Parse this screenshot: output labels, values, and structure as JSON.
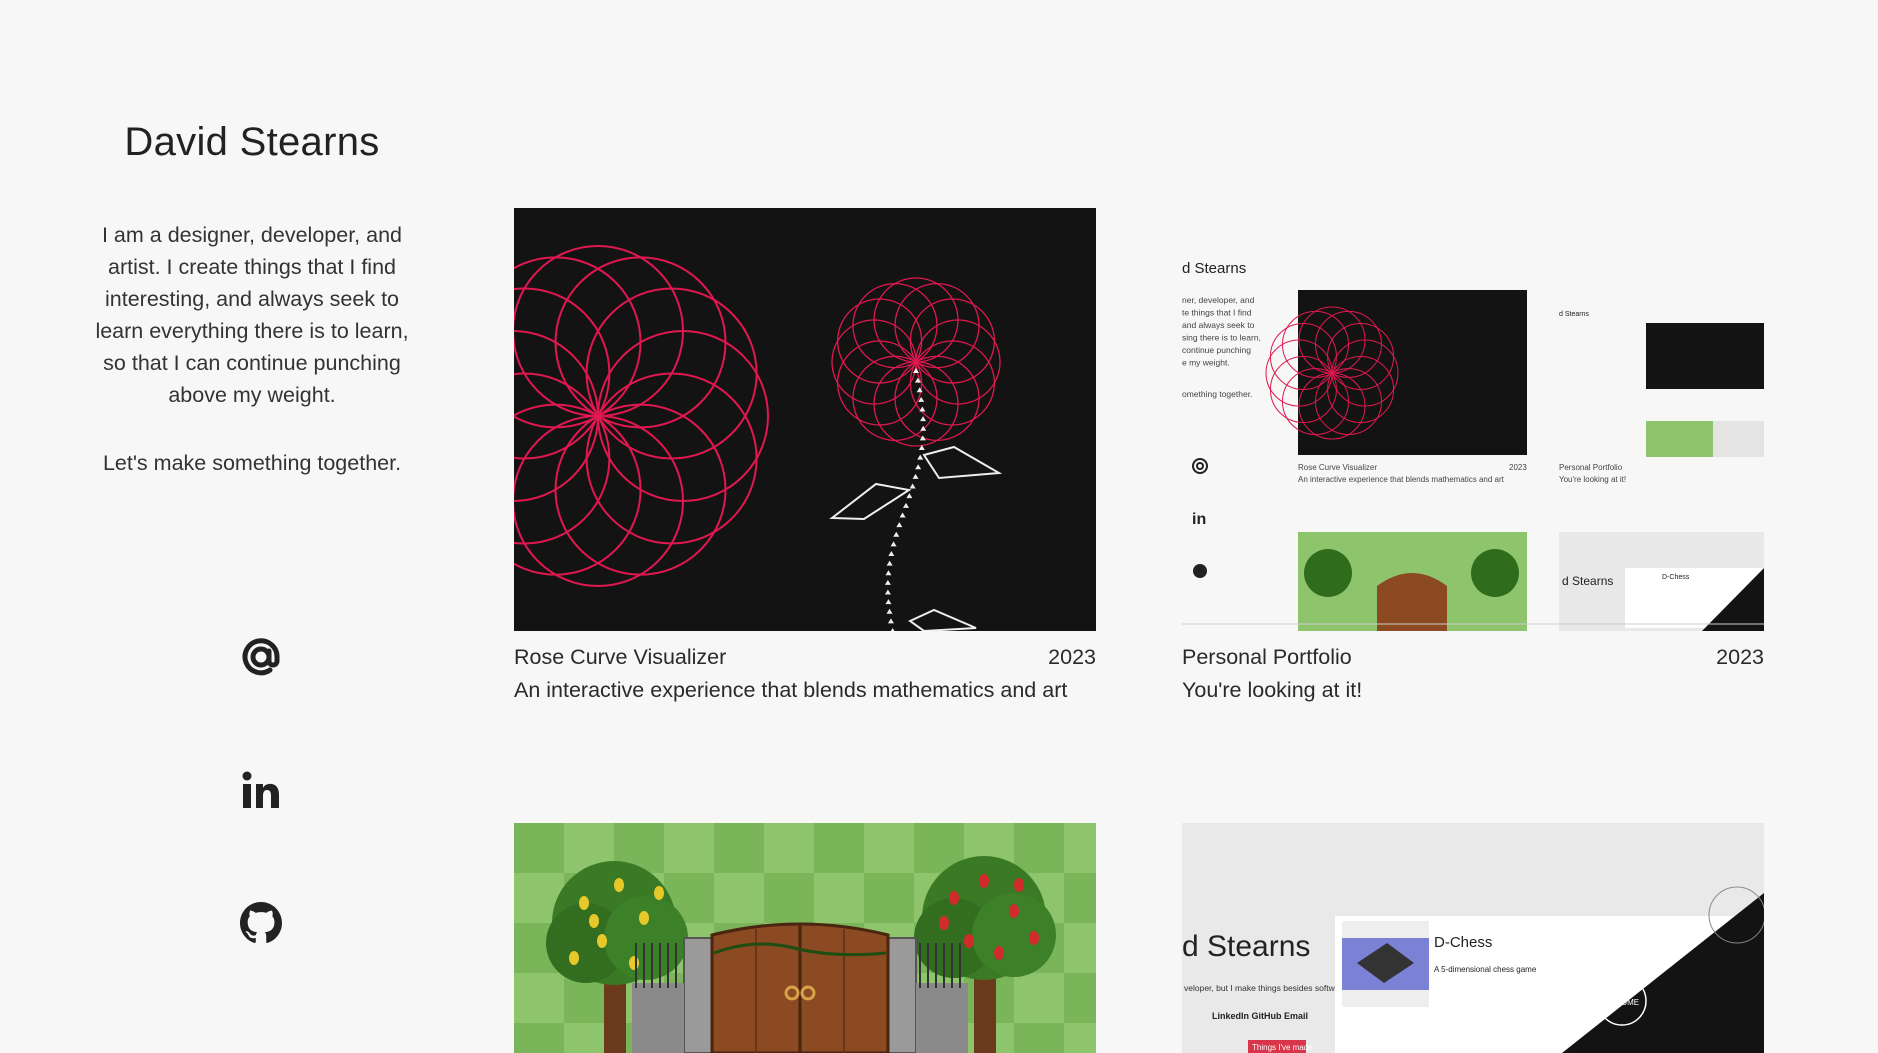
{
  "profile": {
    "name": "David Stearns",
    "bio": "I am a designer, developer, and artist. I create things that I find interesting, and always seek to learn everything there is to learn, so that I can continue punching above my weight.",
    "cta": "Let's make something together."
  },
  "social": [
    {
      "icon": "at-icon",
      "label": "Email"
    },
    {
      "icon": "linkedin-icon",
      "label": "LinkedIn"
    },
    {
      "icon": "github-icon",
      "label": "GitHub"
    }
  ],
  "projects": [
    {
      "title": "Rose Curve Visualizer",
      "year": "2023",
      "description": "An interactive experience that blends mathematics and art"
    },
    {
      "title": "Personal Portfolio",
      "year": "2023",
      "description": "You're looking at it!"
    },
    {
      "title": "",
      "year": "",
      "description": ""
    },
    {
      "title": "",
      "year": "",
      "description": ""
    }
  ],
  "preview": {
    "name_fragment": "d Stearns",
    "bio_fragment": [
      "ner, developer, and",
      "te things that I find",
      "and always seek to",
      "sing there is to learn,",
      "continue punching",
      "e my weight."
    ],
    "cta_fragment": "omething together.",
    "card1_title": "Rose Curve Visualizer",
    "card1_year": "2023",
    "card1_desc": "An interactive experience that blends mathematics and art",
    "card2_title": "Personal Portfolio",
    "card2_desc": "You're looking at it!",
    "small_name": "d Stearns",
    "dchess_title": "D-Chess",
    "dchess_desc": "A 5-dimensional chess game",
    "links": "LinkedIn  GitHub  Email",
    "things_button": "Things I've made",
    "resume": "RESUME",
    "side_text": "veloper, but I make things besides software, too.",
    "bottom_name": "Stearns"
  },
  "colors": {
    "background": "#f7f7f7",
    "rose": "#e0184f",
    "dark_panel": "#131313",
    "grass_light": "#8ec46c",
    "grass_dark": "#7ab55a",
    "wood": "#8b4a22",
    "chess_blue": "#7b82d6"
  }
}
